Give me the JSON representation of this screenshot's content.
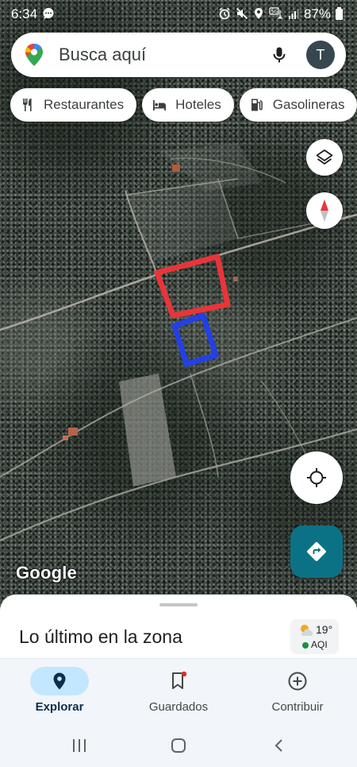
{
  "status_bar": {
    "time": "6:34",
    "battery": "87%"
  },
  "search": {
    "placeholder": "Busca aquí",
    "avatar_letter": "T"
  },
  "chips": [
    {
      "label": "Restaurantes",
      "icon": "restaurant-icon"
    },
    {
      "label": "Hoteles",
      "icon": "hotel-icon"
    },
    {
      "label": "Gasolineras",
      "icon": "gas-station-icon"
    }
  ],
  "map": {
    "attribution": "Google",
    "annotations": [
      {
        "shape": "red-outline",
        "color": "#e8353a"
      },
      {
        "shape": "blue-outline",
        "color": "#2340e6"
      }
    ]
  },
  "sheet": {
    "title": "Lo último en la zona",
    "weather": {
      "temperature": "19°",
      "aqi_label": "AQI"
    }
  },
  "nav": [
    {
      "label": "Explorar",
      "active": true
    },
    {
      "label": "Guardados",
      "active": false
    },
    {
      "label": "Contribuir",
      "active": false
    }
  ],
  "colors": {
    "accent": "#0b7285",
    "active_nav": "#c2e7ff",
    "red_marker": "#e8353a",
    "blue_marker": "#2340e6"
  }
}
